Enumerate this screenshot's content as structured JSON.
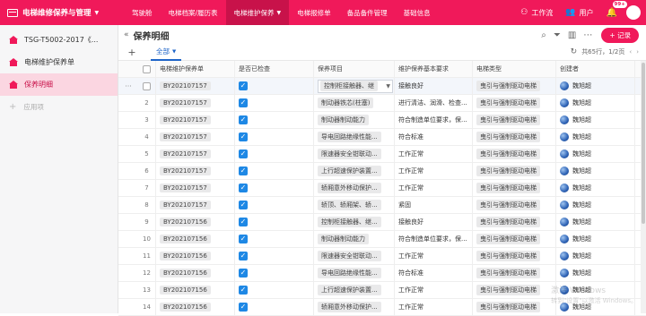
{
  "topbar": {
    "app_title": "电梯维修保养与管理",
    "tabs": [
      "驾驶舱",
      "电梯档案/履历表",
      "电梯维护保养",
      "电梯报修单",
      "备品备件管理",
      "基础信息"
    ],
    "active_tab_index": 2,
    "workflow_label": "工作流",
    "user_label": "用户",
    "badge": "99+"
  },
  "sidebar": {
    "items": [
      {
        "label": "TSG-T5002-2017《..."
      },
      {
        "label": "电梯维护保养单"
      },
      {
        "label": "保养明细"
      }
    ],
    "active_index": 2,
    "add_label": "应用项"
  },
  "main": {
    "title": "保养明细",
    "record_button": "+ 记录",
    "view_tab": "全部",
    "pager_text": "共65行，1/2页"
  },
  "table": {
    "headers": [
      "电梯维护保养单",
      "是否已检查",
      "保养项目",
      "维护保养基本要求",
      "电梯类型",
      "创建者"
    ],
    "rows": [
      {
        "idx": "",
        "order": "BY202107157",
        "item": "控制柜接触器、继",
        "req": "接触良好",
        "type": "曳引与强制驱动电梯",
        "creator": "魏旭超"
      },
      {
        "idx": "2",
        "order": "BY202107157",
        "item": "制动器铁芯(柱塞)",
        "req": "进行清洁、润滑、检查...",
        "type": "曳引与强制驱动电梯",
        "creator": "魏旭超"
      },
      {
        "idx": "3",
        "order": "BY202107157",
        "item": "制动器制动能力",
        "req": "符合制造单位要求，保...",
        "type": "曳引与强制驱动电梯",
        "creator": "魏旭超"
      },
      {
        "idx": "4",
        "order": "BY202107157",
        "item": "导电回路绝缘性能...",
        "req": "符合标准",
        "type": "曳引与强制驱动电梯",
        "creator": "魏旭超"
      },
      {
        "idx": "5",
        "order": "BY202107157",
        "item": "限速器安全钳联动...",
        "req": "工作正常",
        "type": "曳引与强制驱动电梯",
        "creator": "魏旭超"
      },
      {
        "idx": "6",
        "order": "BY202107157",
        "item": "上行超速保护装置...",
        "req": "工作正常",
        "type": "曳引与强制驱动电梯",
        "creator": "魏旭超"
      },
      {
        "idx": "7",
        "order": "BY202107157",
        "item": "轿厢意外移动保护...",
        "req": "工作正常",
        "type": "曳引与强制驱动电梯",
        "creator": "魏旭超"
      },
      {
        "idx": "8",
        "order": "BY202107157",
        "item": "轿顶、轿厢架、轿...",
        "req": "紧固",
        "type": "曳引与强制驱动电梯",
        "creator": "魏旭超"
      },
      {
        "idx": "9",
        "order": "BY202107156",
        "item": "控制柜接触器、继...",
        "req": "接触良好",
        "type": "曳引与强制驱动电梯",
        "creator": "魏旭超"
      },
      {
        "idx": "10",
        "order": "BY202107156",
        "item": "制动器制动能力",
        "req": "符合制造单位要求，保...",
        "type": "曳引与强制驱动电梯",
        "creator": "魏旭超"
      },
      {
        "idx": "11",
        "order": "BY202107156",
        "item": "限速器安全钳联动...",
        "req": "工作正常",
        "type": "曳引与强制驱动电梯",
        "creator": "魏旭超"
      },
      {
        "idx": "12",
        "order": "BY202107156",
        "item": "导电回路绝缘性能...",
        "req": "符合标准",
        "type": "曳引与强制驱动电梯",
        "creator": "魏旭超"
      },
      {
        "idx": "13",
        "order": "BY202107156",
        "item": "上行超速保护装置...",
        "req": "工作正常",
        "type": "曳引与强制驱动电梯",
        "creator": "魏旭超"
      },
      {
        "idx": "14",
        "order": "BY202107156",
        "item": "轿厢意外移动保护...",
        "req": "工作正常",
        "type": "曳引与强制驱动电梯",
        "creator": "魏旭超"
      }
    ]
  },
  "watermark": {
    "line1": "激活 Windows",
    "line2": "转到\"设置\"以激活 Windows。"
  },
  "colors": {
    "brand": "#f0195a",
    "checkbox": "#1e88e5",
    "link": "#1e64c8"
  }
}
